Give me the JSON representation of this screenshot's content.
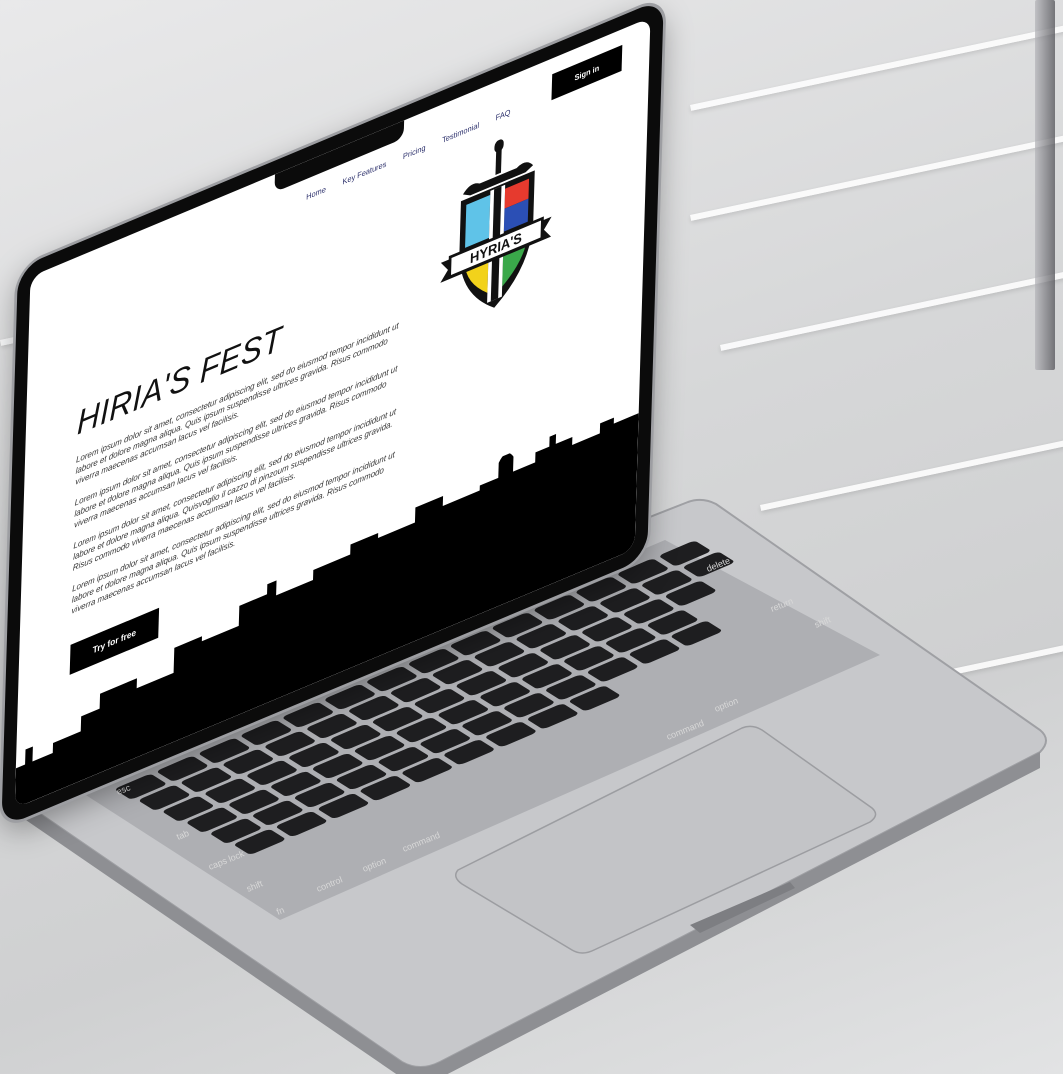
{
  "nav": {
    "links": [
      "Home",
      "Key Features",
      "Pricing",
      "Testimonial",
      "FAQ"
    ],
    "signin_label": "Sign in"
  },
  "hero": {
    "title": "HIRIA'S FEST",
    "paragraphs": [
      "Lorem ipsum dolor sit amet, consectetur adipiscing elit, sed do eiusmod tempor incididunt ut labore et dolore magna aliqua. Quis ipsum suspendisse ultrices gravida. Risus commodo viverra maecenas accumsan lacus vel facilisis.",
      "Lorem ipsum dolor sit amet, consectetur adipiscing elit, sed do eiusmod tempor incididunt ut labore et dolore magna aliqua. Quis ipsum suspendisse ultrices gravida. Risus commodo viverra maecenas accumsan lacus vel facilisis.",
      "Lorem ipsum dolor sit amet, consectetur adipiscing elit, sed do eiusmod tempor incididunt ut labore et dolore magna aliqua. Quisvoglio il cazzo di pinzoum suspendisse ultrices gravida. Risus commodo viverra maecenas accumsan lacus vel facilisis.",
      "Lorem ipsum dolor sit amet, consectetur adipiscing elit, sed do eiusmod tempor incididunt ut labore et dolore magna aliqua. Quis ipsum suspendisse ultrices gravida. Risus commodo viverra maecenas accumsan lacus vel facilisis."
    ],
    "cta_label": "Try for free"
  },
  "logo": {
    "text": "HYRIA'S"
  },
  "keyboard": {
    "labels": [
      "esc",
      "tab",
      "caps lock",
      "shift",
      "fn",
      "control",
      "option",
      "command",
      "command",
      "option",
      "return",
      "shift",
      "delete"
    ]
  },
  "colors": {
    "accent": "#000000",
    "nav_text": "#2b2f6b",
    "logo_cyan": "#5fc3e8",
    "logo_red": "#e63a2e",
    "logo_blue": "#2b4fb5",
    "logo_green": "#3aa84a",
    "logo_yellow": "#f2d21b"
  }
}
